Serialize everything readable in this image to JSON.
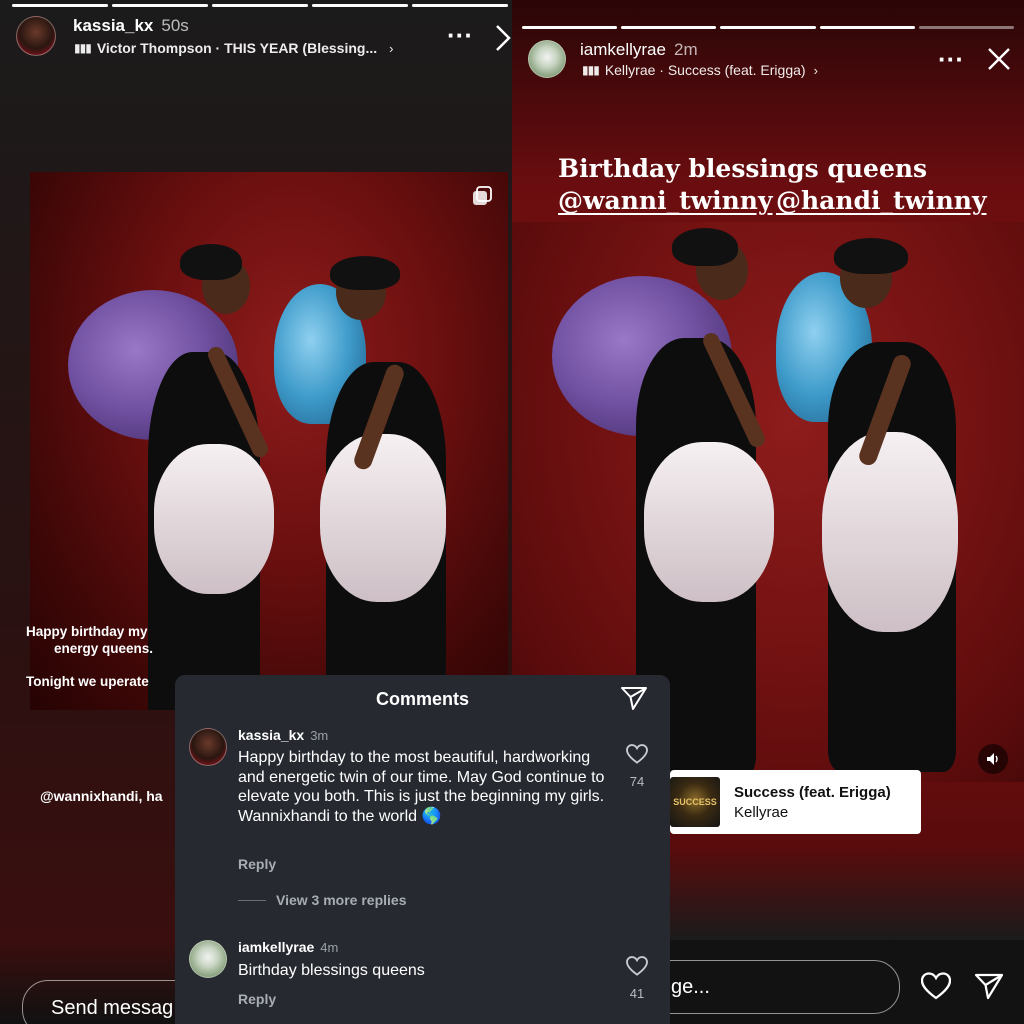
{
  "left_story": {
    "username": "kassia_kx",
    "time": "50s",
    "music": "Victor Thompson · THIS YEAR (Blessing...",
    "text_lines": [
      "Happy birthday  my",
      "energy queens.",
      "Tonight we uperate"
    ],
    "mention_text": "@wannixhandi, ha",
    "send_placeholder": "Send messag"
  },
  "right_story": {
    "username": "iamkellyrae",
    "time": "2m",
    "music": "Kellyrae · Success (feat. Erigga)",
    "headline": "Birthday blessings queens",
    "mentions": [
      "@wanni_twinny",
      "@handi_twinny"
    ],
    "music_card": {
      "album_text": "SUCCESS",
      "song": "Success (feat. Erigga)",
      "artist": "Kellyrae"
    },
    "send_placeholder": "ge..."
  },
  "comments_panel": {
    "title": "Comments",
    "comments": [
      {
        "user": "kassia_kx",
        "time": "3m",
        "text": "Happy birthday to the most beautiful, hardworking and energetic twin of our time. May God continue to elevate you both. This is just the beginning my girls. Wannixhandi to the world 🌎",
        "likes": "74",
        "reply": "Reply",
        "more_replies": "View 3 more replies"
      },
      {
        "user": "iamkellyrae",
        "time": "4m",
        "text": "Birthday blessings queens",
        "likes": "41",
        "reply": "Reply"
      }
    ]
  },
  "icons": {
    "more": "more-icon",
    "close": "close-icon",
    "next": "chevron-right-icon",
    "send": "send-icon",
    "heart": "heart-icon",
    "sound": "volume-icon",
    "gallery": "multiple-photos-icon",
    "music_bars": "music-bars-icon"
  },
  "colors": {
    "backdrop_red": "#7d1113",
    "sheet_bg": "#262a30",
    "purple_headpiece": "#6e4e9e",
    "blue_headpiece": "#3d9ac9"
  }
}
